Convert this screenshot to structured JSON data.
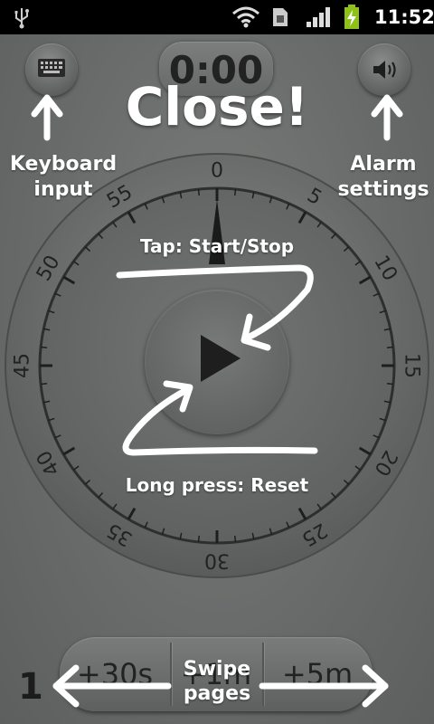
{
  "status_bar": {
    "time": "11:52",
    "icons": [
      "usb-icon",
      "wifi-icon",
      "sim-card-icon",
      "signal-icon",
      "battery-charging-icon"
    ]
  },
  "top": {
    "keyboard_icon": "keyboard-icon",
    "timer_display": "0:00",
    "alarm_icon": "speaker-icon"
  },
  "overlay": {
    "title": "Close!",
    "keyboard_hint": "Keyboard\ninput",
    "alarm_hint": "Alarm\nsettings",
    "tap_hint": "Tap: Start/Stop",
    "long_press_hint": "Long press: Reset",
    "swipe_hint": "Swipe\npages"
  },
  "dial": {
    "labels": [
      "0",
      "5",
      "10",
      "15",
      "20",
      "25",
      "30",
      "35",
      "40",
      "45",
      "50",
      "55"
    ],
    "play_icon": "play-icon"
  },
  "presets": [
    "+30s",
    "+1m",
    "+5m"
  ],
  "page_number": "1",
  "colors": {
    "background": "#6e706f",
    "status_bar": "#000000",
    "battery": "#8ec11a",
    "overlay_text": "#ffffff",
    "dial_text": "#222222"
  }
}
